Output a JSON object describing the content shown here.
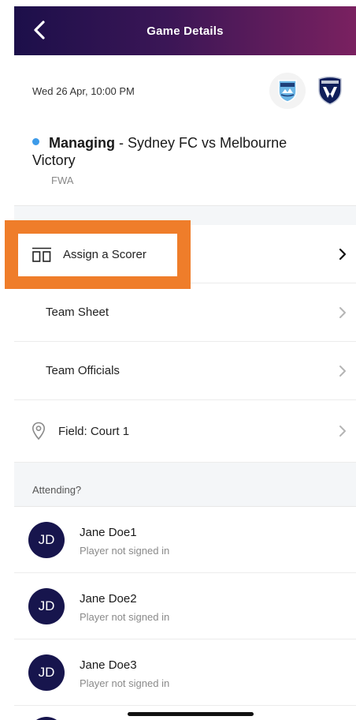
{
  "header": {
    "title": "Game Details"
  },
  "game": {
    "date": "Wed 26 Apr, 10:00 PM",
    "role": "Managing",
    "separator": " - ",
    "matchup": "Sydney FC vs Melbourne Victory",
    "competition": "FWA",
    "status_color": "#3d9be9",
    "home_badge_icon": "sydney-fc-crest-icon",
    "away_badge_icon": "melbourne-victory-crest-icon"
  },
  "menu": {
    "assign_scorer": "Assign a Scorer",
    "team_sheet": "Team Sheet",
    "team_officials": "Team Officials",
    "field": "Field: Court 1"
  },
  "attending": {
    "header": "Attending?",
    "players": [
      {
        "initials": "JD",
        "name": "Jane Doe1",
        "status": "Player not signed in"
      },
      {
        "initials": "JD",
        "name": "Jane Doe2",
        "status": "Player not signed in"
      },
      {
        "initials": "JD",
        "name": "Jane Doe3",
        "status": "Player not signed in"
      }
    ]
  },
  "colors": {
    "highlight": "#ef7d2a",
    "avatar": "#17154d",
    "header_gradient_start": "#1c0f4a",
    "header_gradient_end": "#7a2160"
  }
}
